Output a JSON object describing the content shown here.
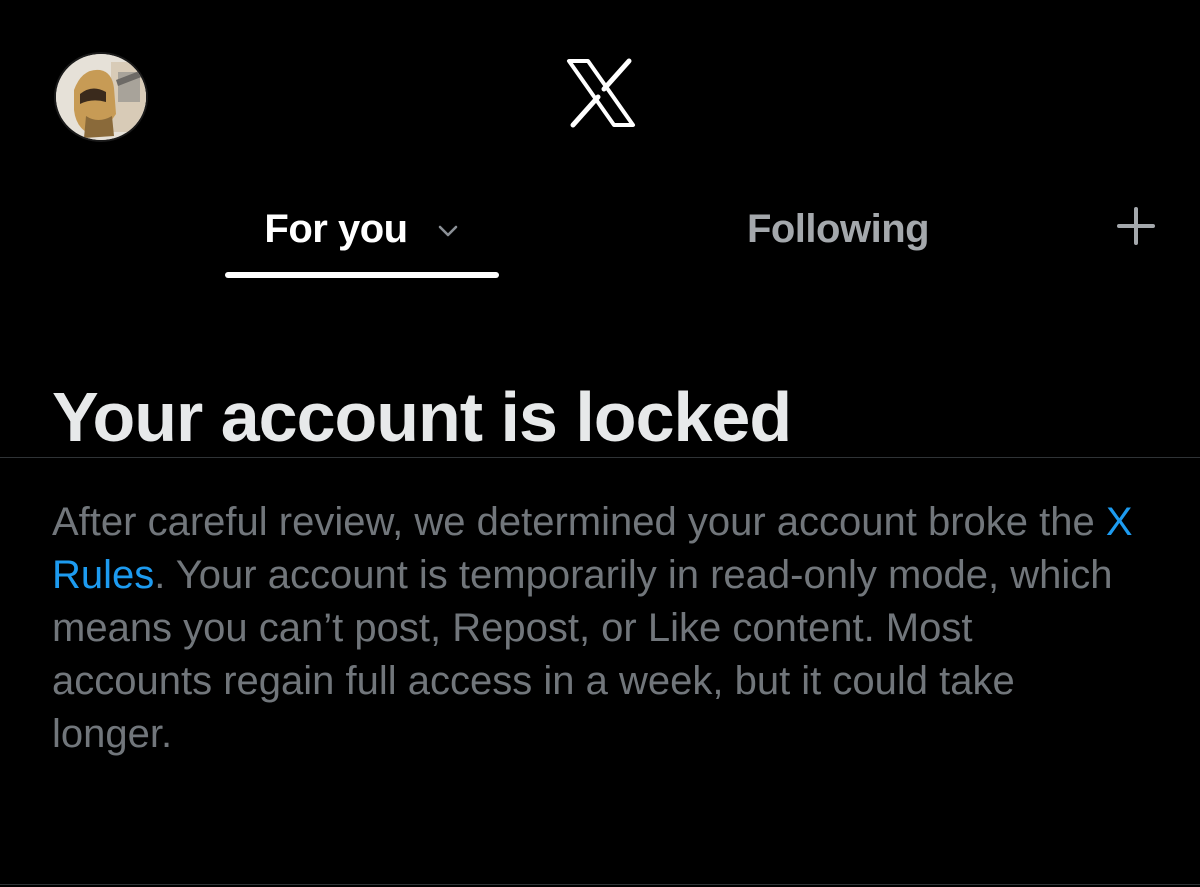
{
  "header": {
    "avatar_icon": "user-avatar",
    "logo_icon": "x-logo"
  },
  "tabs": [
    {
      "label": "For you",
      "active": true,
      "icon": "chevron-down-icon"
    },
    {
      "label": "Following",
      "active": false
    }
  ],
  "add_tab_icon": "plus-icon",
  "notice": {
    "title": "Your account is locked",
    "body_before_link": "After careful review, we determined your account broke the ",
    "link_text": "X Rules",
    "body_after_link": ". Your account is temporarily in read-only mode, which means you can’t post, Repost, or Like content. Most accounts regain full access in a week, but it could take longer."
  },
  "colors": {
    "background": "#000000",
    "title_text": "#e7e9ea",
    "body_text": "#71767b",
    "link": "#1d9bf0",
    "inactive_tab": "#a4a8ac",
    "divider": "#2f3336"
  }
}
